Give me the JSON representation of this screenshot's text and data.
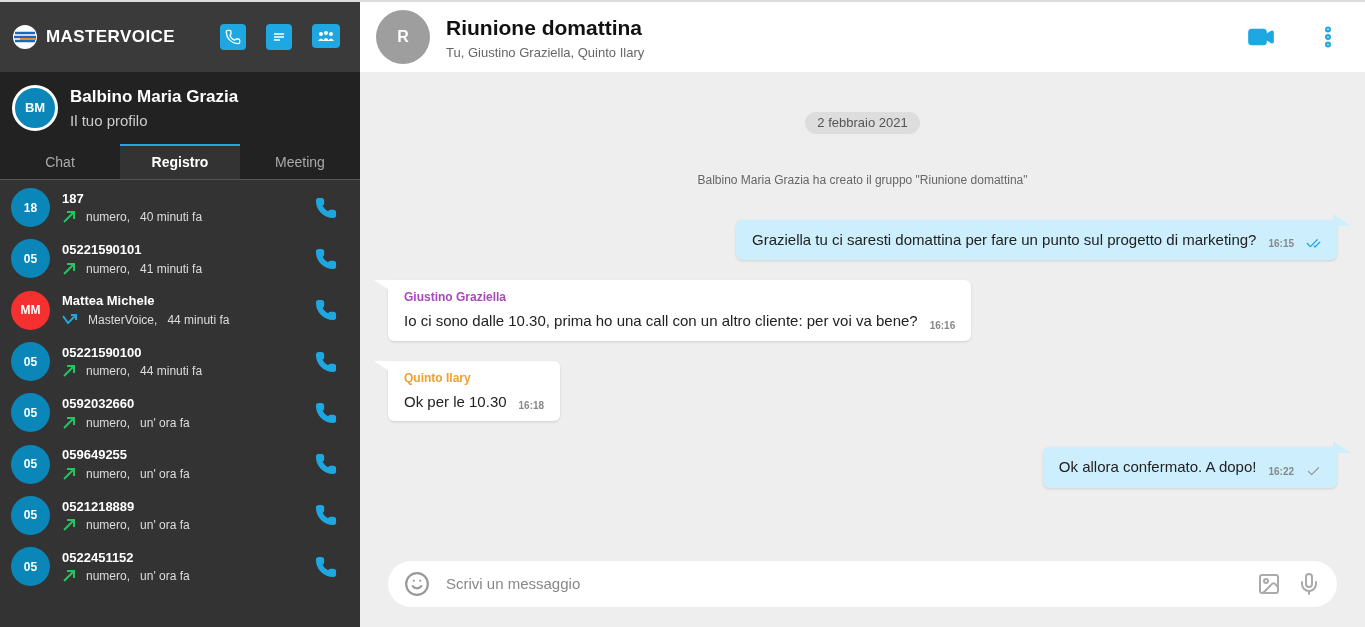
{
  "brand": {
    "name": "MASTERVOICE"
  },
  "profile": {
    "initials": "BM",
    "name": "Balbino Maria Grazia",
    "subtitle": "Il tuo profilo"
  },
  "tabs": [
    {
      "label": "Chat",
      "selected": false
    },
    {
      "label": "Registro",
      "selected": true
    },
    {
      "label": "Meeting",
      "selected": false
    }
  ],
  "calls": [
    {
      "initials": "18",
      "color": "#0a86b8",
      "name": "187",
      "kind": "outgoing",
      "source": "numero,",
      "time": "40 minuti fa"
    },
    {
      "initials": "05",
      "color": "#0a86b8",
      "name": "05221590101",
      "kind": "outgoing",
      "source": "numero,",
      "time": "41 minuti fa"
    },
    {
      "initials": "MM",
      "color": "#f5302f",
      "name": "Mattea Michele",
      "kind": "missed",
      "source": "MasterVoice,",
      "time": "44 minuti fa"
    },
    {
      "initials": "05",
      "color": "#0a86b8",
      "name": "05221590100",
      "kind": "outgoing",
      "source": "numero,",
      "time": "44 minuti fa"
    },
    {
      "initials": "05",
      "color": "#0a86b8",
      "name": "0592032660",
      "kind": "outgoing",
      "source": "numero,",
      "time": "un' ora fa"
    },
    {
      "initials": "05",
      "color": "#0a86b8",
      "name": "059649255",
      "kind": "outgoing",
      "source": "numero,",
      "time": "un' ora fa"
    },
    {
      "initials": "05",
      "color": "#0a86b8",
      "name": "0521218889",
      "kind": "outgoing",
      "source": "numero,",
      "time": "un' ora fa"
    },
    {
      "initials": "05",
      "color": "#0a86b8",
      "name": "0522451152",
      "kind": "outgoing",
      "source": "numero,",
      "time": "un' ora fa"
    }
  ],
  "conversation": {
    "initial": "R",
    "title": "Riunione domattina",
    "members": "Tu, Giustino Graziella, Quinto Ilary"
  },
  "date": "2 febbraio 2021",
  "system_message": "Balbino Maria Grazia ha creato il gruppo \"Riunione domattina\"",
  "messages": [
    {
      "kind": "outgoing",
      "text": "Graziella tu ci saresti domattina per fare un punto sul progetto di marketing?",
      "time": "16:15",
      "read": true
    },
    {
      "kind": "incoming",
      "sender": "Giustino Graziella",
      "color": "#ab47bc",
      "text": "Io ci sono dalle 10.30, prima ho una call con un altro cliente: per voi va bene?",
      "time": "16:16"
    },
    {
      "kind": "incoming",
      "sender": "Quinto Ilary",
      "color": "#f0a030",
      "text": "Ok per le 10.30",
      "time": "16:18"
    },
    {
      "kind": "outgoing",
      "text": "Ok allora confermato. A dopo!",
      "time": "16:22",
      "read": false
    }
  ],
  "composer": {
    "placeholder": "Scrivi un messaggio"
  }
}
